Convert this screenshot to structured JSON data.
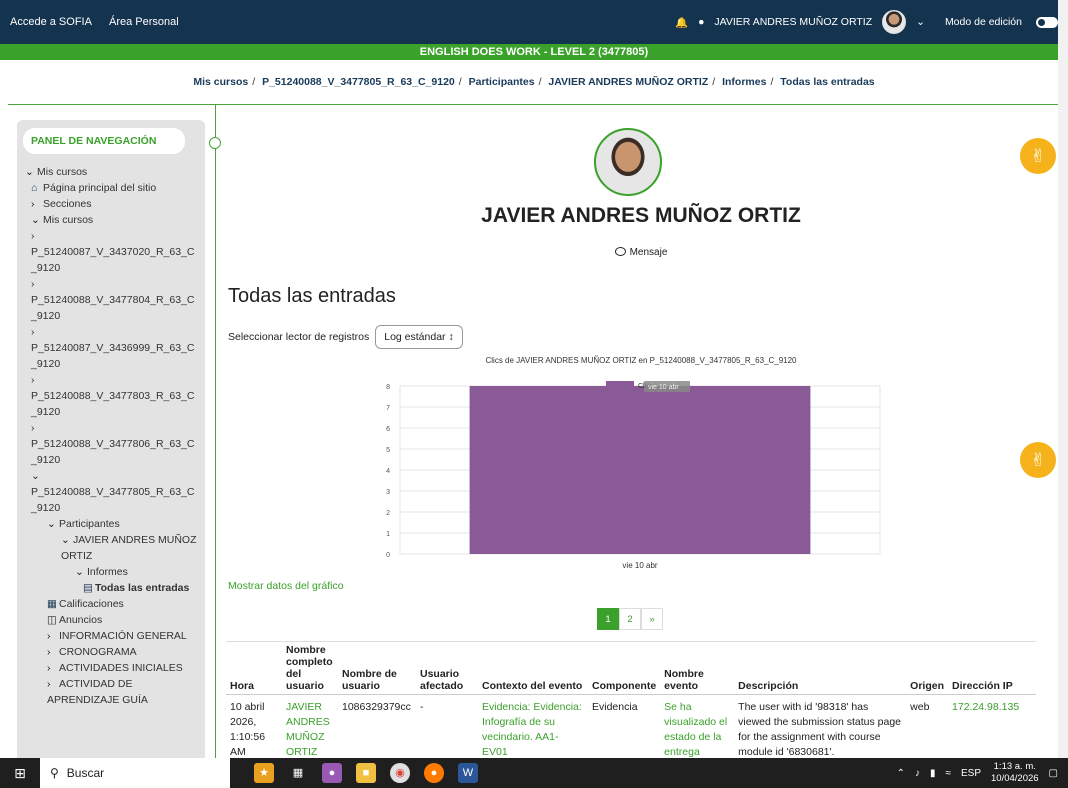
{
  "topbar": {
    "link1": "Accede a SOFIA",
    "link2": "Área Personal",
    "user_name": "JAVIER ANDRES MUÑOZ ORTIZ",
    "edit_mode_label": "Modo de edición"
  },
  "course_title": "ENGLISH DOES WORK - LEVEL 2 (3477805)",
  "breadcrumb": [
    "Mis cursos",
    "P_51240088_V_3477805_R_63_C_9120",
    "Participantes",
    "JAVIER ANDRES MUÑOZ ORTIZ",
    "Informes",
    "Todas las entradas"
  ],
  "sidebar": {
    "title": "PANEL DE NAVEGACIÓN",
    "mis_cursos": "Mis cursos",
    "home": "Página principal del sitio",
    "secciones": "Secciones",
    "mis_cursos2": "Mis cursos",
    "courses": [
      "P_51240087_V_3437020_R_63_C_9120",
      "P_51240088_V_3477804_R_63_C_9120",
      "P_51240087_V_3436999_R_63_C_9120",
      "P_51240088_V_3477803_R_63_C_9120",
      "P_51240088_V_3477806_R_63_C_9120",
      "P_51240088_V_3477805_R_63_C_9120"
    ],
    "participantes": "Participantes",
    "user": "JAVIER ANDRES MUÑOZ ORTIZ",
    "informes": "Informes",
    "todas": "Todas las entradas",
    "calificaciones": "Calificaciones",
    "anuncios": "Anuncios",
    "sections": [
      "INFORMACIÓN GENERAL",
      "CRONOGRAMA",
      "ACTIVIDADES INICIALES",
      "ACTIVIDAD DE APRENDIZAJE GUÍA"
    ]
  },
  "profile": {
    "name": "JAVIER ANDRES MUÑOZ ORTIZ",
    "message": "Mensaje"
  },
  "page_heading": "Todas las entradas",
  "selector": {
    "label": "Seleccionar lector de registros",
    "value": "Log estándar"
  },
  "chart_data": {
    "type": "bar",
    "title": "Clics de JAVIER ANDRES MUÑOZ ORTIZ  en P_51240088_V_3477805_R_63_C_9120",
    "categories": [
      "vie 10 abr"
    ],
    "series": [
      {
        "name": "Clics",
        "values": [
          8
        ]
      }
    ],
    "ylim": [
      0,
      8
    ],
    "yticks": [
      0,
      1,
      2,
      3,
      4,
      5,
      6,
      7,
      8
    ],
    "color": "#8a5a96",
    "legend": "top",
    "tooltip": "vie 10 abr",
    "grid": true
  },
  "show_data_link": "Mostrar datos del gráfico",
  "pagination": [
    "1",
    "2",
    "»"
  ],
  "table": {
    "headers": [
      "Hora",
      "Nombre completo del usuario",
      "Nombre de usuario",
      "Usuario afectado",
      "Contexto del evento",
      "Componente",
      "Nombre evento",
      "Descripción",
      "Origen",
      "Dirección IP"
    ],
    "rows": [
      [
        "10 abril 2026, 1:10:56 AM",
        "JAVIER ANDRES MUÑOZ ORTIZ",
        "1086329379cc",
        "-",
        "Evidencia: Evidencia: Infografía de su vecindario. AA1-EV01",
        "Evidencia",
        "Se ha visualizado el estado de la entrega",
        "The user with id '98318' has viewed the submission status page for the assignment with course module id '6830681'.",
        "web",
        "172.24.98.135"
      ]
    ]
  },
  "taskbar": {
    "search": "Buscar",
    "lang": "ESP",
    "time": "1:13 a. m.",
    "date": "10/04/2026"
  }
}
